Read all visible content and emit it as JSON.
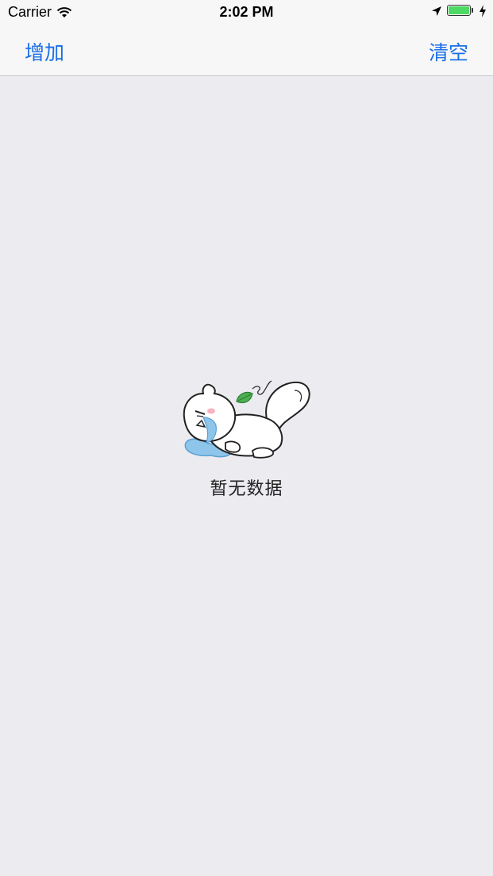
{
  "status_bar": {
    "carrier": "Carrier",
    "time": "2:02 PM",
    "icons": [
      "wifi-icon",
      "location-arrow-icon",
      "battery-icon",
      "charging-icon"
    ],
    "battery_color": "#4cd964"
  },
  "nav": {
    "left_button": "增加",
    "right_button": "清空",
    "tint_color": "#1a6fe6"
  },
  "empty_state": {
    "illustration": "crying-cat-icon",
    "message": "暂无数据"
  }
}
